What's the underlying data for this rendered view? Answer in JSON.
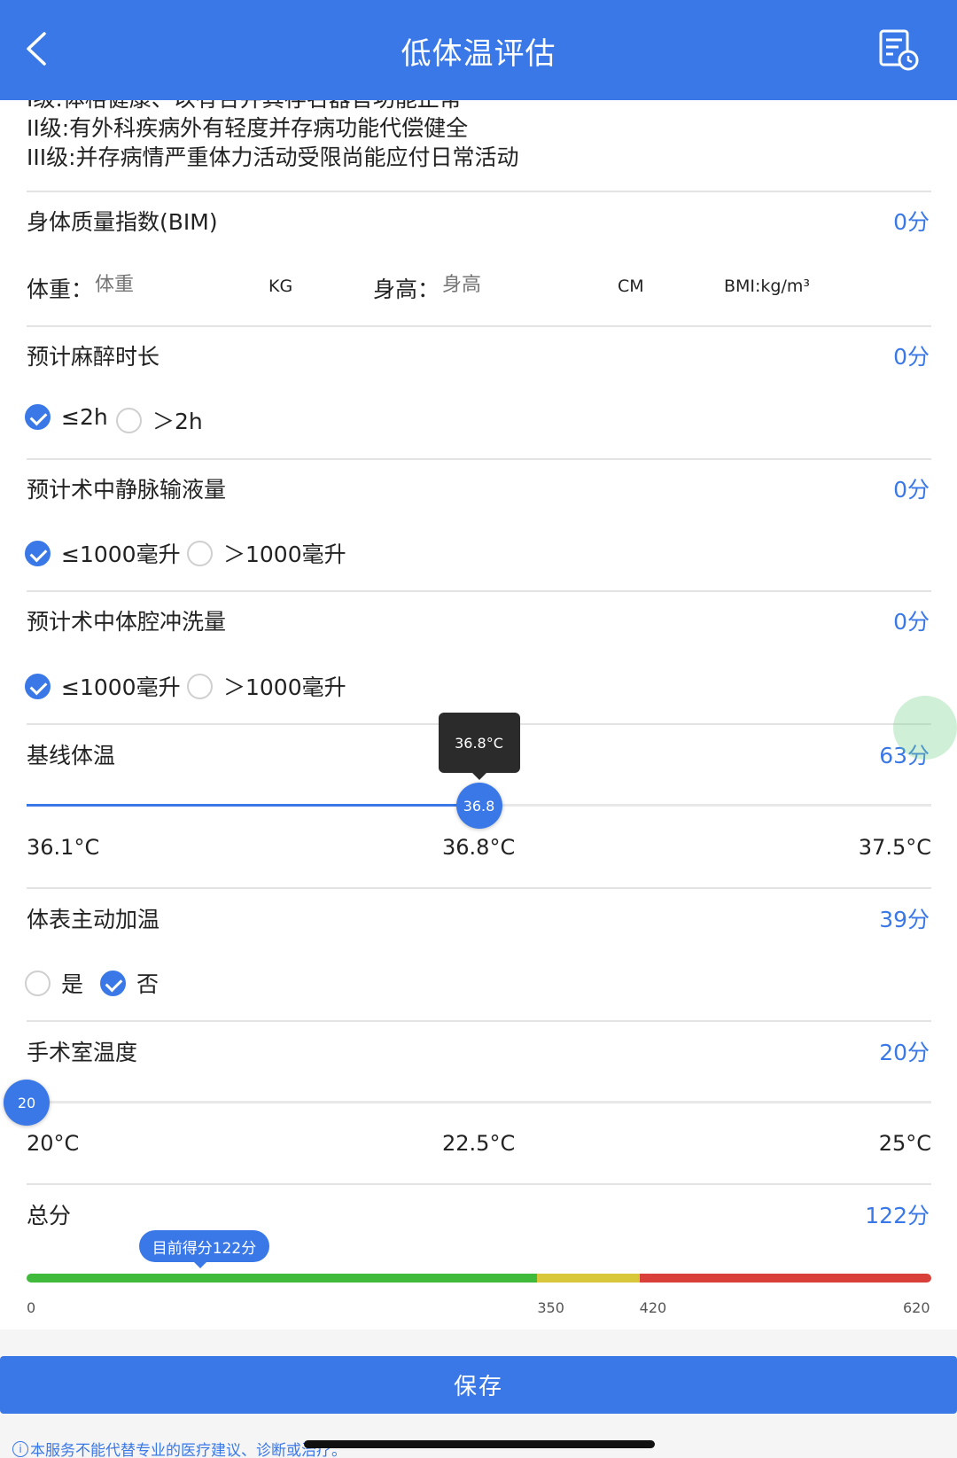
{
  "header": {
    "title": "低体温评估"
  },
  "grade": {
    "line_partial": "I级:体格健康、以有合并其存名器官功能正常",
    "line2": "II级:有外科疾病外有轻度并存病功能代偿健全",
    "line3": "III级:并存病情严重体力活动受限尚能应付日常活动"
  },
  "bmi": {
    "label": "身体质量指数(BIM)",
    "score": "0分",
    "weight_label": "体重：",
    "weight_placeholder": "体重",
    "weight_unit": "KG",
    "height_label": "身高：",
    "height_placeholder": "身高",
    "height_unit": "CM",
    "bmi_unit": "BMI:kg/m³"
  },
  "anesthesia": {
    "label": "预计麻醉时长",
    "score": "0分",
    "options": [
      "≤2h",
      "＞2h"
    ],
    "selected": 0
  },
  "infusion": {
    "label": "预计术中静脉输液量",
    "score": "0分",
    "options": [
      "≤1000毫升",
      "＞1000毫升"
    ],
    "selected": 0
  },
  "lavage": {
    "label": "预计术中体腔冲洗量",
    "score": "0分",
    "options": [
      "≤1000毫升",
      "＞1000毫升"
    ],
    "selected": 0
  },
  "baseline_temp": {
    "label": "基线体温",
    "score": "63分",
    "min_label": "36.1°C",
    "mid_label": "36.8°C",
    "max_label": "37.5°C",
    "value": 36.8,
    "value_label": "36.8",
    "tooltip": "36.8°C",
    "min": 36.1,
    "max": 37.5
  },
  "active_warming": {
    "label": "体表主动加温",
    "score": "39分",
    "options": [
      "是",
      "否"
    ],
    "selected": 1
  },
  "room_temp": {
    "label": "手术室温度",
    "score": "20分",
    "min_label": "20°C",
    "mid_label": "22.5°C",
    "max_label": "25°C",
    "value": 20,
    "value_label": "20",
    "min": 20,
    "max": 25
  },
  "total": {
    "label": "总分",
    "score": "122分",
    "bubble": "目前得分122分",
    "value": 122,
    "scale_labels": [
      "0",
      "350",
      "420",
      "620"
    ],
    "thresholds": [
      0,
      350,
      420,
      620
    ],
    "colors": {
      "low": "#3fba3a",
      "mid": "#d8c73a",
      "high": "#d9403a"
    }
  },
  "footer": {
    "save_label": "保存",
    "disclaimer": "本服务不能代替专业的医疗建议、诊断或治疗。"
  },
  "accent_color": "#3a78e8"
}
